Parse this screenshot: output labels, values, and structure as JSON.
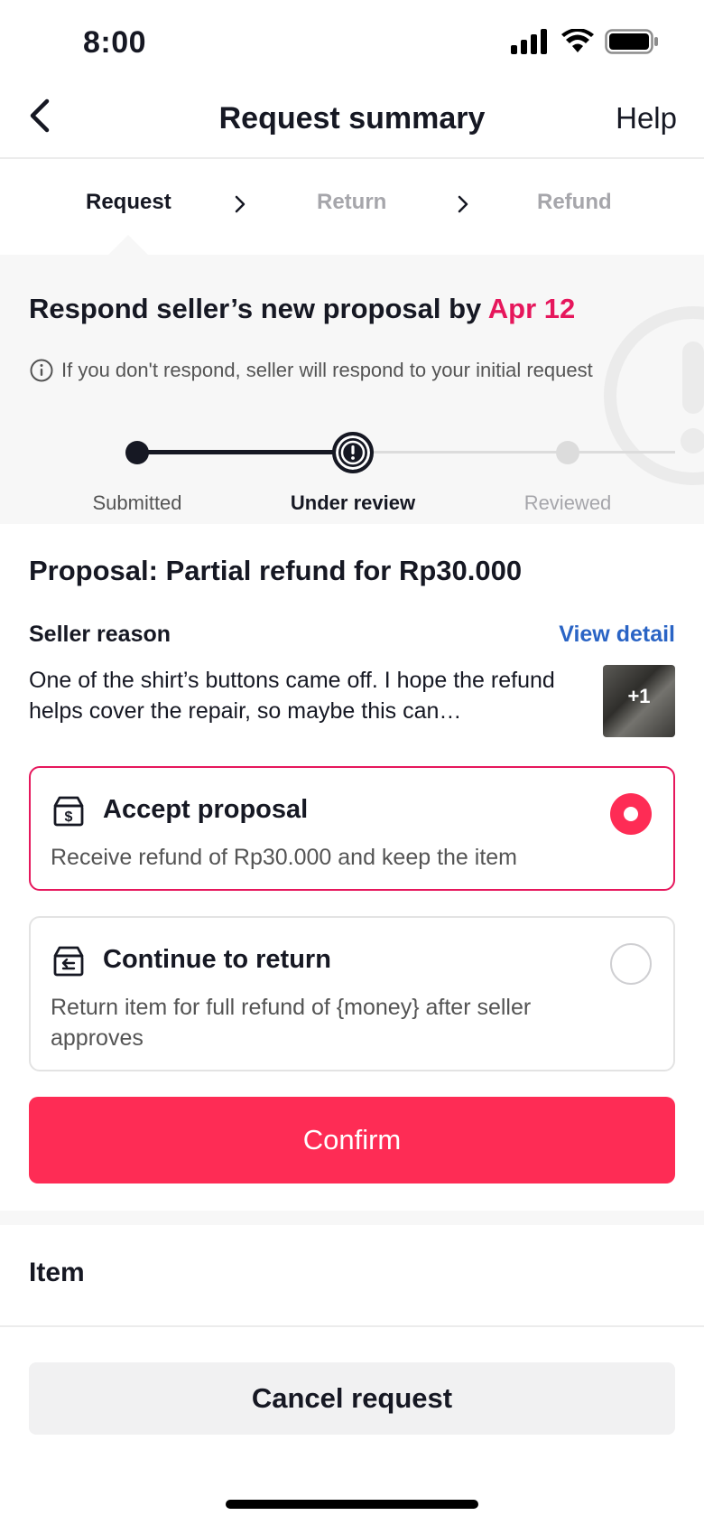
{
  "status_bar": {
    "time": "8:00"
  },
  "nav": {
    "title": "Request summary",
    "help": "Help"
  },
  "steps": [
    {
      "label": "Request"
    },
    {
      "label": "Return"
    },
    {
      "label": "Refund"
    }
  ],
  "status": {
    "title_prefix": "Respond seller’s new proposal by ",
    "deadline": "Apr 12",
    "note": "If you don't respond, seller will respond to your initial request",
    "timeline": [
      {
        "label": "Submitted"
      },
      {
        "label": "Under review"
      },
      {
        "label": "Reviewed"
      }
    ]
  },
  "proposal": {
    "title": "Proposal: Partial refund for Rp30.000",
    "seller_reason_label": "Seller reason",
    "view_detail": "View detail",
    "seller_reason_text": "One of the shirt’s buttons came off. I hope the refund helps cover the repair, so maybe this can…",
    "photo_count": "+1"
  },
  "options": [
    {
      "title": "Accept proposal",
      "desc": "Receive refund of Rp30.000 and keep the item",
      "selected": true
    },
    {
      "title": "Continue to return",
      "desc": "Return item for full refund of {money} after seller approves",
      "selected": false
    }
  ],
  "buttons": {
    "confirm": "Confirm",
    "cancel": "Cancel request"
  },
  "item_section": {
    "label": "Item"
  },
  "colors": {
    "accent": "#fe2c55",
    "deadline": "#e6175c",
    "link": "#2a64c5",
    "muted": "#a6a6ab"
  },
  "icons": [
    "signal-icon",
    "wifi-icon",
    "battery-icon",
    "back-arrow-icon",
    "chevron-right-icon",
    "info-icon",
    "alert-icon",
    "refund-box-icon",
    "return-box-icon"
  ]
}
